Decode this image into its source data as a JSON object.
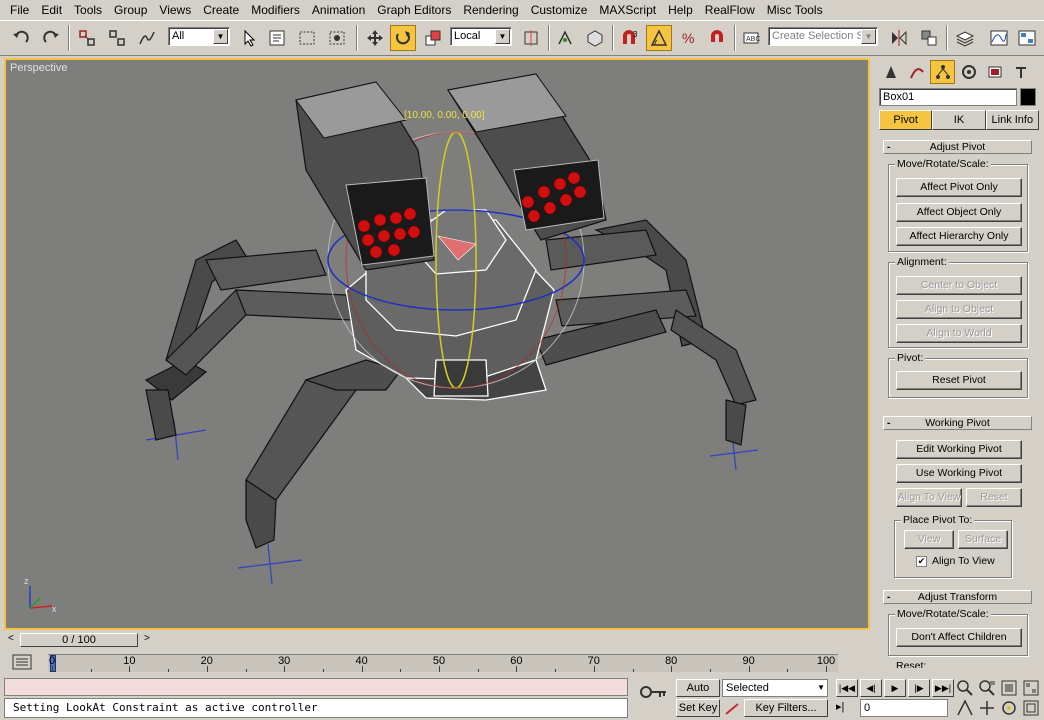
{
  "menu": [
    "File",
    "Edit",
    "Tools",
    "Group",
    "Views",
    "Create",
    "Modifiers",
    "Animation",
    "Graph Editors",
    "Rendering",
    "Customize",
    "MAXScript",
    "Help",
    "RealFlow",
    "Misc Tools"
  ],
  "toolbar": {
    "filter_value": "All",
    "coord_system": "Local",
    "selection_set_placeholder": "Create Selection Set",
    "snap_count": "3"
  },
  "viewport": {
    "label": "Perspective",
    "gizmo_readout": "[10.00, 0.00, 0.00]",
    "axis_x": "x",
    "axis_z": "z"
  },
  "command_panel": {
    "object_name": "Box01",
    "object_color": "#000000",
    "tabs": [
      "Pivot",
      "IK",
      "Link Info"
    ],
    "adjust_pivot": {
      "title": "Adjust Pivot",
      "move_group": "Move/Rotate/Scale:",
      "affect_pivot_only": "Affect Pivot Only",
      "affect_object_only": "Affect Object Only",
      "affect_hierarchy_only": "Affect Hierarchy Only",
      "alignment_group": "Alignment:",
      "center_to_object": "Center to Object",
      "align_to_object": "Align to Object",
      "align_to_world": "Align to World",
      "pivot_group": "Pivot:",
      "reset_pivot": "Reset Pivot"
    },
    "working_pivot": {
      "title": "Working Pivot",
      "edit_working_pivot": "Edit Working Pivot",
      "use_working_pivot": "Use Working Pivot",
      "align_to_view": "Align To View",
      "reset": "Reset",
      "place_pivot_group": "Place Pivot To:",
      "view": "View",
      "surface": "Surface",
      "align_to_view_check": "Align To View"
    },
    "adjust_transform": {
      "title": "Adjust Transform",
      "move_group": "Move/Rotate/Scale:",
      "dont_affect_children": "Don't Affect Children",
      "reset_group": "Reset:"
    }
  },
  "timeline": {
    "frame_display": "0 / 100",
    "ticks": [
      "0",
      "10",
      "20",
      "30",
      "40",
      "50",
      "60",
      "70",
      "80",
      "90",
      "100"
    ]
  },
  "status": {
    "message": "Setting LookAt Constraint as active controller",
    "auto_key": "Auto Key",
    "set_key": "Set Key",
    "selected": "Selected",
    "key_filters": "Key Filters...",
    "current_frame": "0"
  },
  "colors": {
    "accent": "#f5c542",
    "viewport_bg": "#7e7e7c"
  }
}
